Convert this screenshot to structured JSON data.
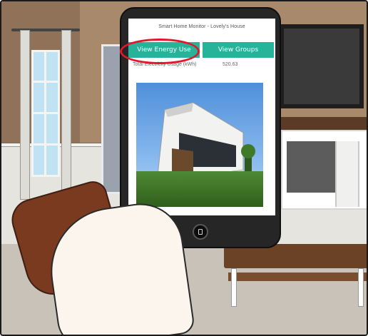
{
  "app": {
    "title": "Smart Home Monitor - Lovely's House"
  },
  "toolbar": {
    "energy_label": "View Energy Use",
    "groups_label": "View Groups"
  },
  "usage": {
    "label": "Total Electricity Usage (kWh)",
    "value": "520.63"
  },
  "icons": {
    "home_button": "home-button-icon"
  },
  "colors": {
    "button_bg": "#26b39a",
    "highlight": "#e0182a",
    "tablet_body": "#262626"
  }
}
